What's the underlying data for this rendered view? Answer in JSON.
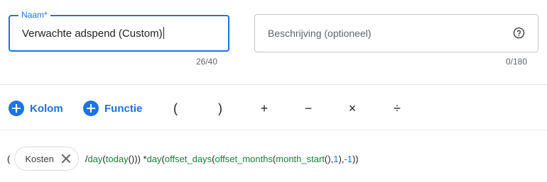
{
  "name_field": {
    "label": "Naam*",
    "value": "Verwachte adspend (Custom)",
    "counter": "26/40"
  },
  "description_field": {
    "placeholder": "Beschrijving (optioneel)",
    "help_icon": "help-circle-icon",
    "counter": "0/180"
  },
  "toolbar": {
    "add_column_label": "Kolom",
    "add_function_label": "Functie",
    "add_icon": "add-circle-icon",
    "operators": {
      "open_paren": "(",
      "close_paren": ")",
      "plus": "+",
      "minus": "−",
      "multiply": "×",
      "divide": "÷"
    }
  },
  "formula": {
    "open_paren": "(",
    "chip_label": "Kosten",
    "chip_close_icon": "close-icon",
    "tokens": {
      "t1": "/ ",
      "t2": "day",
      "t3": "(",
      "t4": "today",
      "t5": "())) * ",
      "t6": "day",
      "t7": "(",
      "t8": "offset_days",
      "t9": "(",
      "t10": "offset_months",
      "t11": "(",
      "t12": "month_start",
      "t13": "(), ",
      "t14": "1",
      "t15": "), ",
      "t16": "-1",
      "t17": "))"
    }
  },
  "colors": {
    "accent": "#1a73e8",
    "function_green": "#188038",
    "text": "#202124",
    "muted": "#5f6368",
    "border": "#c4c7c5"
  }
}
